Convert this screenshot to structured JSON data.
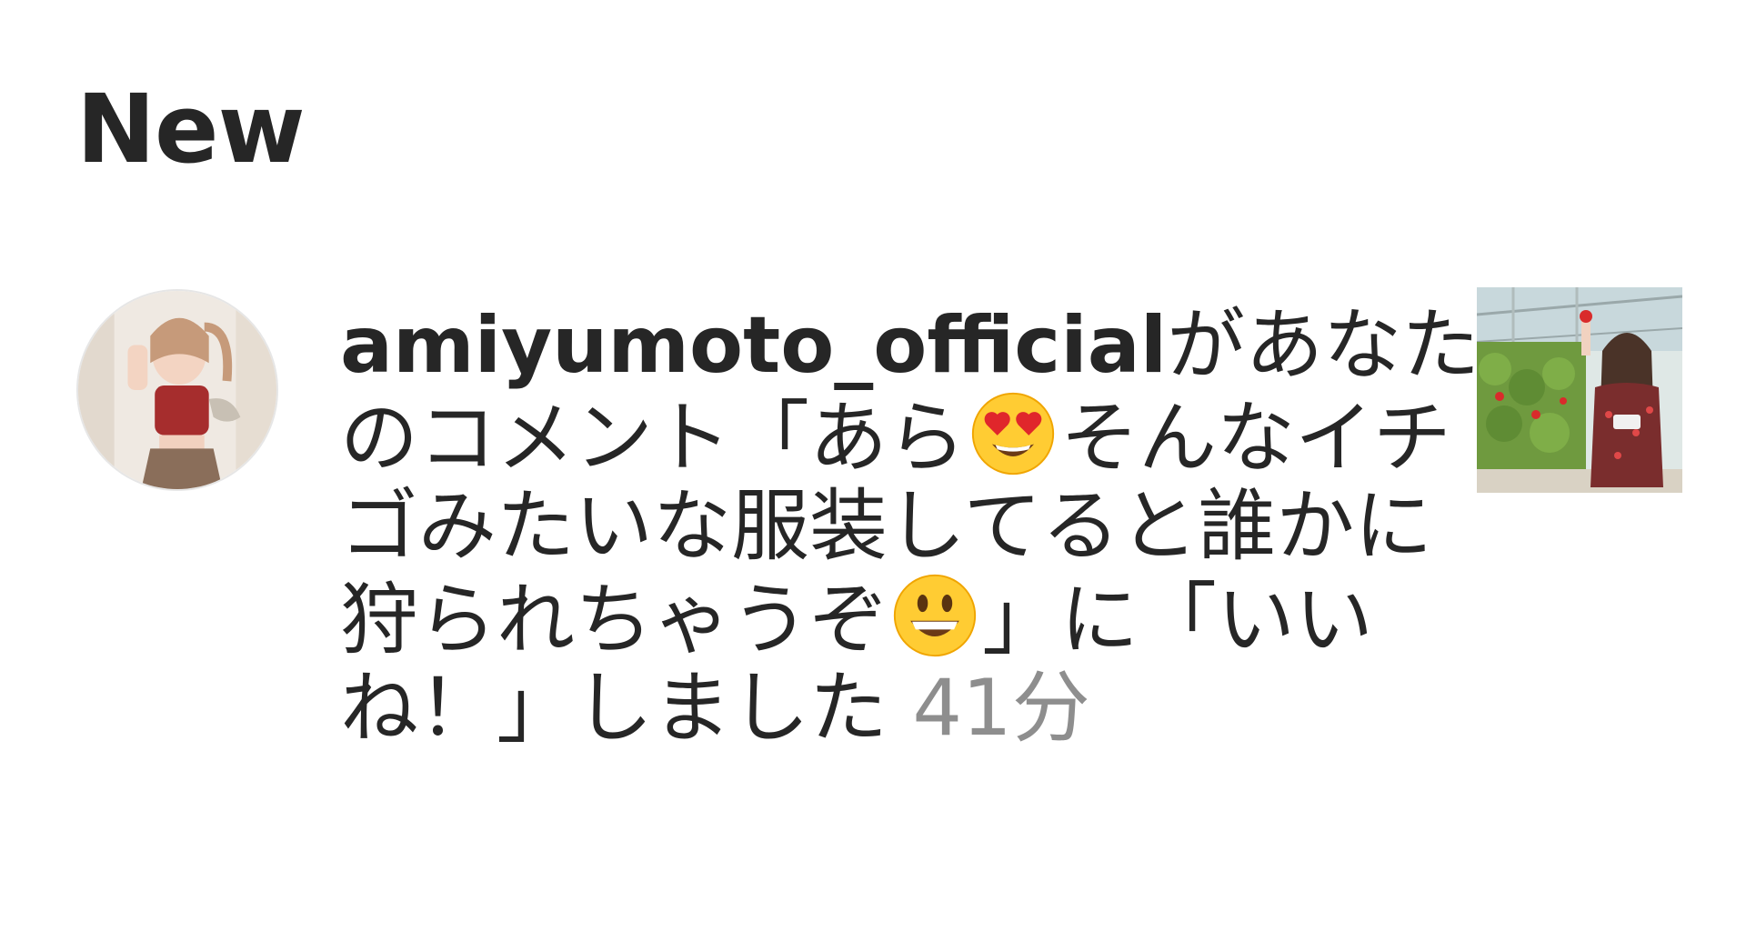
{
  "section": {
    "title": "New"
  },
  "notification": {
    "username": "amiyumoto_official",
    "text_part1": "があなたのコメント「あら",
    "emoji1": "smiling-face-with-heart-eyes",
    "text_part2": "そんなイチゴみたいな服装してると誰かに狩られちゃうぞ",
    "emoji2": "grinning-face",
    "text_part3": "」に「いいね！」しました",
    "time": "41分"
  }
}
